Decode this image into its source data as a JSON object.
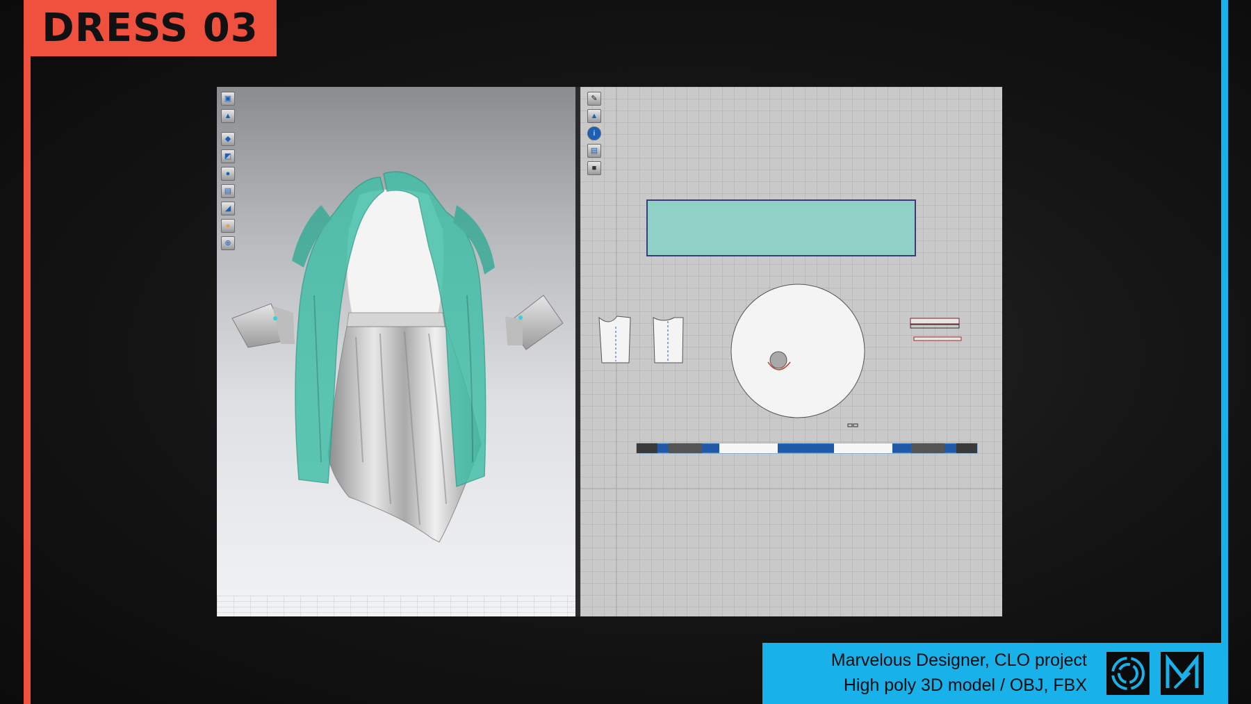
{
  "title": "DRESS 03",
  "info": {
    "line1": "Marvelous Designer, CLO project",
    "line2": "High poly 3D model / OBJ, FBX"
  },
  "logos": [
    "clo-logo-icon",
    "marvelous-designer-logo-icon"
  ],
  "colors": {
    "accent_left": "#f0503e",
    "accent_right": "#19b1ea",
    "fabric_teal": "#3fbfa7",
    "fabric_silver": "#cfcfcf"
  },
  "toolbar_3d_icons": [
    "avatar-display-icon",
    "garment-icon",
    "fitting-icon",
    "texture-icon",
    "avatar-icon",
    "surface-icon",
    "shading-icon",
    "skin-icon",
    "render-globe-icon"
  ],
  "toolbar_2d_icons": [
    "pen-icon",
    "garment-2d-icon",
    "info-icon",
    "paper-icon",
    "lock-icon"
  ]
}
